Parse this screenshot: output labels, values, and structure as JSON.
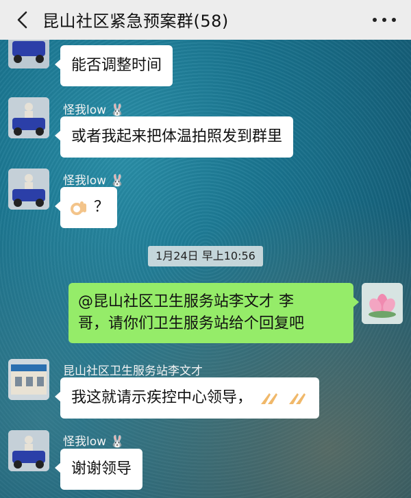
{
  "header": {
    "title": "昆山社区紧急预案群(58)"
  },
  "messages": [
    {
      "sender": "",
      "text": "能否调整时间"
    },
    {
      "sender": "怪我low",
      "text": "或者我起来把体温拍照发到群里"
    },
    {
      "sender": "怪我low",
      "text": "？",
      "emoji": "ok-hand-emoji"
    },
    {
      "timestamp": "1月24日 早上10:56"
    },
    {
      "outgoing": true,
      "text_line1": "@昆山社区卫生服务站李文才  李",
      "text_line2": "哥，请你们卫生服务站给个回复吧"
    },
    {
      "sender": "昆山社区卫生服务站李文才",
      "text": "我这就请示疾控中心领导，",
      "emoji": "pray-emoji"
    },
    {
      "sender": "怪我low",
      "text": "谢谢领导"
    }
  ],
  "colors": {
    "outgoing_bubble": "#95ec69",
    "incoming_bubble": "#ffffff",
    "topbar": "#ededed"
  }
}
